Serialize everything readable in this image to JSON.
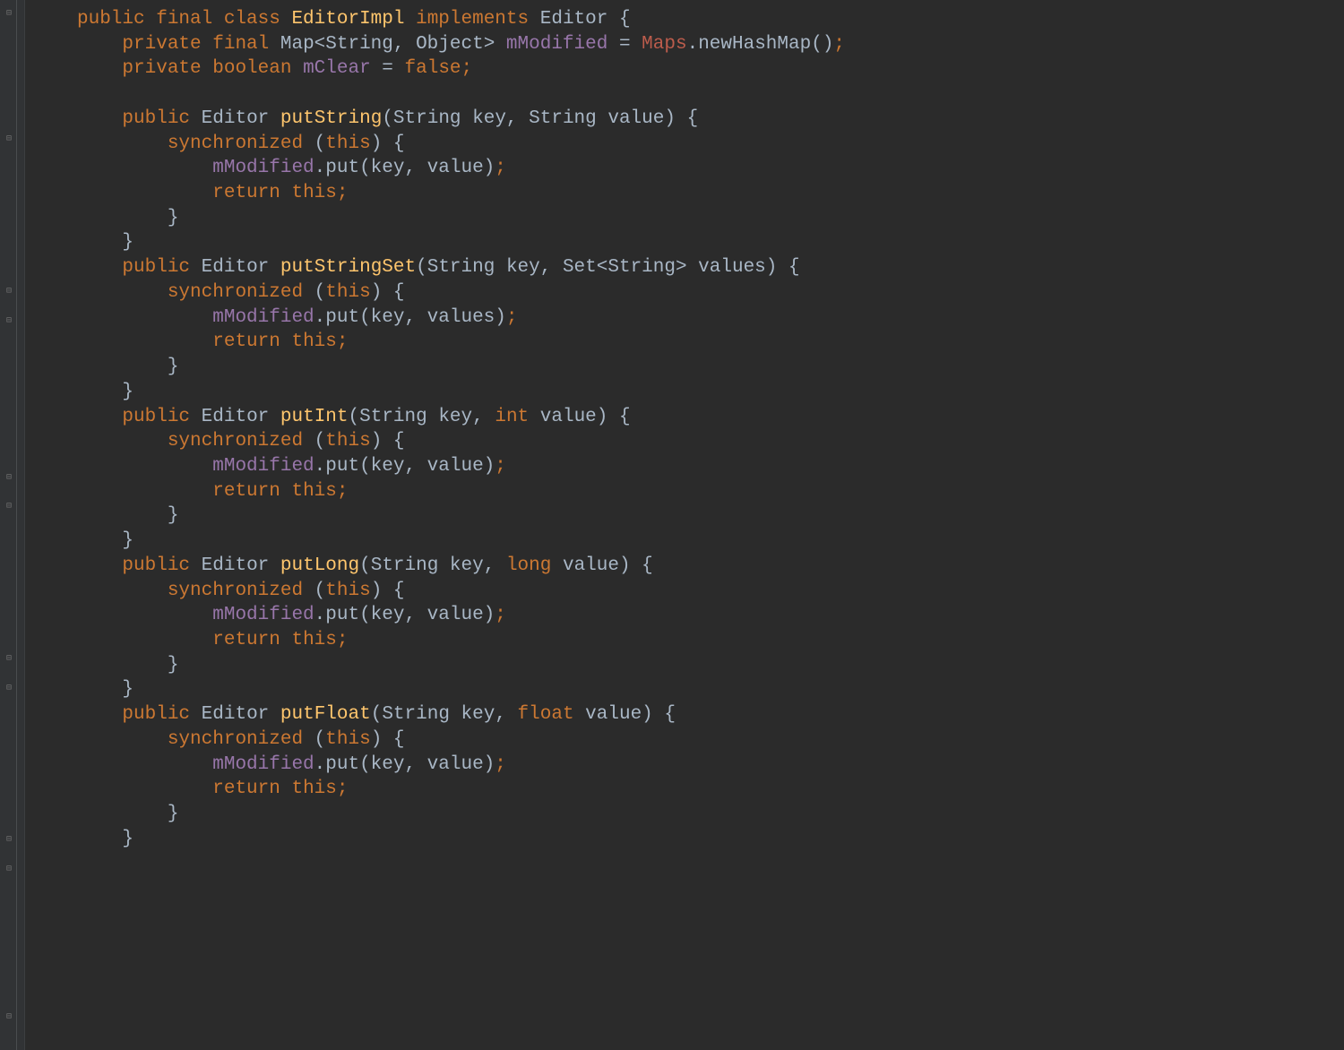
{
  "code": {
    "class_decl": {
      "mods": "public final class",
      "name": "EditorImpl",
      "implements_kw": "implements",
      "super": "Editor",
      "open": "{"
    },
    "field1": {
      "mods": "private final",
      "type": "Map<String, Object>",
      "name": "mModified",
      "eq": "=",
      "lib": "Maps",
      "call": ".newHashMap()",
      "semi": ";"
    },
    "field2": {
      "mods": "private boolean",
      "name": "mClear",
      "eq": "=",
      "val": "false",
      "semi": ";"
    },
    "methods": [
      {
        "mods": "public",
        "ret": "Editor",
        "name": "putString",
        "params": "(String key, String value) {",
        "sync_kw": "synchronized",
        "sync_open": " (",
        "this": "this",
        "sync_close": ") {",
        "body1_field": "mModified",
        "body1_rest": ".put(key, value)",
        "semi": ";",
        "ret_kw": "return",
        "ret_this": "this",
        "ret_semi": ";",
        "close_sync": "}",
        "close_method": "}"
      },
      {
        "mods": "public",
        "ret": "Editor",
        "name": "putStringSet",
        "params": "(String key, Set<String> values) {",
        "sync_kw": "synchronized",
        "sync_open": " (",
        "this": "this",
        "sync_close": ") {",
        "body1_field": "mModified",
        "body1_rest": ".put(key, values)",
        "semi": ";",
        "ret_kw": "return",
        "ret_this": "this",
        "ret_semi": ";",
        "close_sync": "}",
        "close_method": "}"
      },
      {
        "mods": "public",
        "ret": "Editor",
        "name": "putInt",
        "params": "(String key, ",
        "prim": "int",
        "params2": " value) {",
        "sync_kw": "synchronized",
        "sync_open": " (",
        "this": "this",
        "sync_close": ") {",
        "body1_field": "mModified",
        "body1_rest": ".put(key, value)",
        "semi": ";",
        "ret_kw": "return",
        "ret_this": "this",
        "ret_semi": ";",
        "close_sync": "}",
        "close_method": "}"
      },
      {
        "mods": "public",
        "ret": "Editor",
        "name": "putLong",
        "params": "(String key, ",
        "prim": "long",
        "params2": " value) {",
        "sync_kw": "synchronized",
        "sync_open": " (",
        "this": "this",
        "sync_close": ") {",
        "body1_field": "mModified",
        "body1_rest": ".put(key, value)",
        "semi": ";",
        "ret_kw": "return",
        "ret_this": "this",
        "ret_semi": ";",
        "close_sync": "}",
        "close_method": "}"
      },
      {
        "mods": "public",
        "ret": "Editor",
        "name": "putFloat",
        "params": "(String key, ",
        "prim": "float",
        "params2": " value) {",
        "sync_kw": "synchronized",
        "sync_open": " (",
        "this": "this",
        "sync_close": ") {",
        "body1_field": "mModified",
        "body1_rest": ".put(key, value)",
        "semi": ";",
        "ret_kw": "return",
        "ret_this": "this",
        "ret_semi": ";",
        "close_sync": "}",
        "close_method": "}"
      }
    ]
  },
  "indent": {
    "i1": "    ",
    "i2": "        ",
    "i3": "            ",
    "i4": "                "
  }
}
